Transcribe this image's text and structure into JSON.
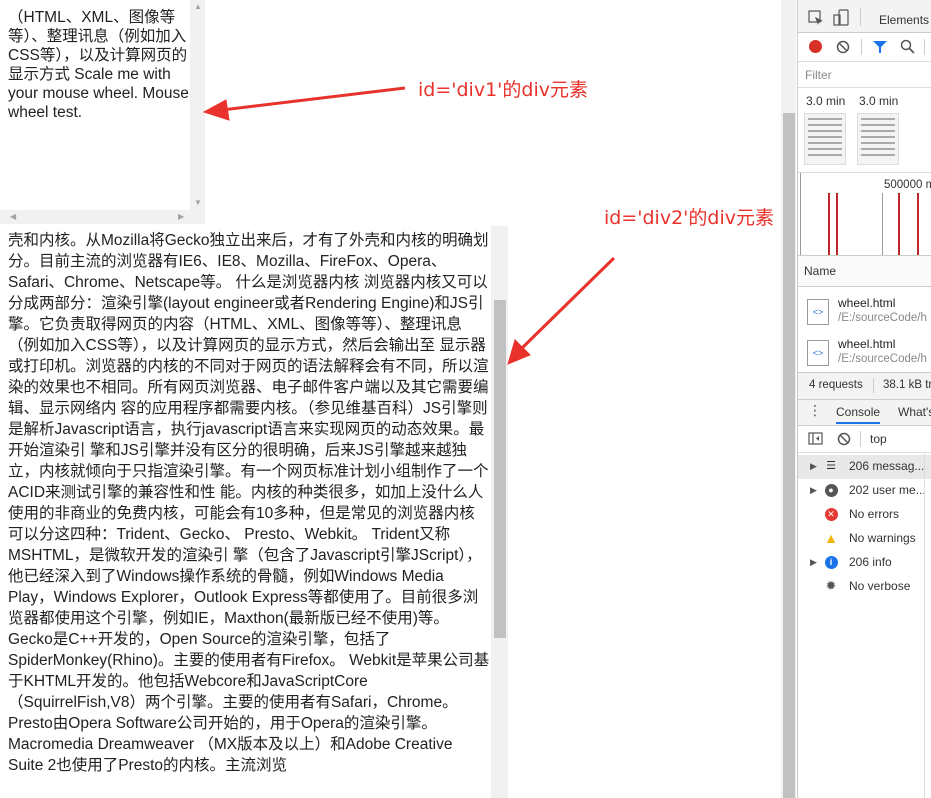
{
  "div1": {
    "text": "（HTML、XML、图像等等）、整理讯息（例如加入CSS等），以及计算网页的显示方式 Scale me with your mouse wheel. Mouse wheel test."
  },
  "div2": {
    "text": "是基于标记语言显示内容的程序或模块。也有一些 浏览器并不区分外壳和内核。从Mozilla将Gecko独立出来后，才有了外壳和内核的明确划分。目前主流的浏览器有IE6、IE8、Mozilla、FireFox、Opera、Safari、Chrome、Netscape等。 什么是浏览器内核 浏览器内核又可以分成两部分：渲染引擎(layout engineer或者Rendering Engine)和JS引擎。它负责取得网页的内容（HTML、XML、图像等等）、整理讯息（例如加入CSS等），以及计算网页的显示方式，然后会输出至 显示器或打印机。浏览器的内核的不同对于网页的语法解释会有不同，所以渲染的效果也不相同。所有网页浏览器、电子邮件客户端以及其它需要编辑、显示网络内 容的应用程序都需要内核。（参见维基百科）JS引擎则是解析Javascript语言，执行javascript语言来实现网页的动态效果。最开始渲染引 擎和JS引擎并没有区分的很明确，后来JS引擎越来越独立，内核就倾向于只指渲染引擎。有一个网页标准计划小组制作了一个ACID来测试引擎的兼容性和性 能。内核的种类很多，如加上没什么人使用的非商业的免费内核，可能会有10多种，但是常见的浏览器内核可以分这四种：Trident、Gecko、 Presto、Webkit。 Trident又称MSHTML，是微软开发的渲染引 擎（包含了Javascript引擎JScript），他已经深入到了Windows操作系统的骨髓，例如Windows Media Play，Windows Explorer，Outlook Express等都使用了。目前很多浏览器都使用这个引擎，例如IE，Maxthon(最新版已经不使用)等。 Gecko是C++开发的，Open Source的渲染引擎，包括了SpiderMonkey(Rhino)。主要的使用者有Firefox。 Webkit是苹果公司基于KHTML开发的。他包括Webcore和JavaScriptCore（SquirrelFish,V8）两个引擎。主要的使用者有Safari，Chrome。 Presto由Opera Software公司开始的，用于Opera的渲染引擎。Macromedia Dreamweaver （MX版本及以上）和Adobe Creative Suite 2也使用了Presto的内核。主流浏览"
  },
  "annotations": {
    "div1_label": "id='div1'的div元素",
    "div2_label": "id='div2'的div元素",
    "color": "#e8322b"
  },
  "devtools": {
    "tab_elements": "Elements",
    "filter_placeholder": "Filter",
    "time1": "3.0 min",
    "time2": "3.0 min",
    "timeline_label": "500000 m",
    "name_header": "Name",
    "requests": [
      {
        "name": "wheel.html",
        "path": "/E:/sourceCode/h"
      },
      {
        "name": "wheel.html",
        "path": "/E:/sourceCode/h"
      }
    ],
    "status_requests": "4 requests",
    "status_size": "38.1 kB tr",
    "console_tab": "Console",
    "whats_tab": "What's",
    "context": "top",
    "sidebar": [
      {
        "label": "206 messag...",
        "icon": "list-icon",
        "expandable": true
      },
      {
        "label": "202 user me...",
        "icon": "user-icon",
        "expandable": true
      },
      {
        "label": "No errors",
        "icon": "error-icon",
        "expandable": false
      },
      {
        "label": "No warnings",
        "icon": "warning-icon",
        "expandable": false
      },
      {
        "label": "206 info",
        "icon": "info-icon",
        "expandable": true
      },
      {
        "label": "No verbose",
        "icon": "bug-icon",
        "expandable": false
      }
    ]
  }
}
